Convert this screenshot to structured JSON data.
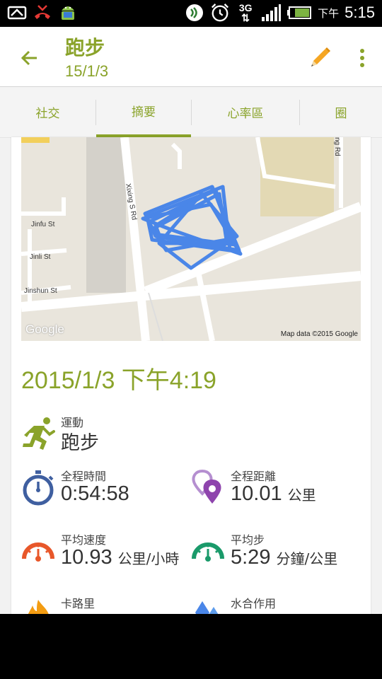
{
  "status_bar": {
    "ampm": "下午",
    "time": "5:15",
    "network": "3G",
    "icons": [
      "screenshot-icon",
      "missed-call-icon",
      "android-icon",
      "nfc-icon",
      "alarm-icon",
      "network-3g-icon",
      "signal-icon",
      "battery-icon"
    ]
  },
  "app_bar": {
    "title": "跑步",
    "subtitle": "15/1/3",
    "back_icon": "arrow-back-icon",
    "edit_icon": "pencil-icon",
    "more_icon": "more-vert-icon"
  },
  "tabs": [
    {
      "label": "社交",
      "active": false
    },
    {
      "label": "摘要",
      "active": true
    },
    {
      "label": "心率區",
      "active": false
    },
    {
      "label": "圈",
      "active": false
    }
  ],
  "map": {
    "streets": [
      "Jinfu St",
      "Jinli St",
      "Jinshun St",
      "Xixing S Rd",
      "ng Rd"
    ],
    "credit": "Map data ©2015 Google",
    "logo": "Google",
    "route_color": "#4a86e8"
  },
  "summary": {
    "datetime": "2015/1/3 下午4:19",
    "activity": {
      "label": "運動",
      "value": "跑步"
    },
    "stats": [
      {
        "id": "duration",
        "label": "全程時間",
        "value": "0:54:58",
        "unit": "",
        "icon": "stopwatch-icon"
      },
      {
        "id": "distance",
        "label": "全程距離",
        "value": "10.01",
        "unit": "公里",
        "icon": "location-pins-icon"
      },
      {
        "id": "avg-speed",
        "label": "平均速度",
        "value": "10.93",
        "unit": "公里/小時",
        "icon": "speedometer-icon"
      },
      {
        "id": "avg-pace",
        "label": "平均步",
        "value": "5:29",
        "unit": "分鐘/公里",
        "icon": "pace-gauge-icon"
      },
      {
        "id": "calories",
        "label": "卡路里",
        "value": "",
        "unit": "",
        "icon": "flame-icon"
      },
      {
        "id": "hydration",
        "label": "水合作用",
        "value": "",
        "unit": "",
        "icon": "water-drops-icon"
      }
    ]
  },
  "colors": {
    "accent": "#8aa32a",
    "stopwatch": "#3f5fa0",
    "pins": "#9b59b6",
    "speedometer": "#e8572a",
    "pace": "#1a9a6a",
    "flame": "#f39c12",
    "water": "#4a86e8"
  }
}
